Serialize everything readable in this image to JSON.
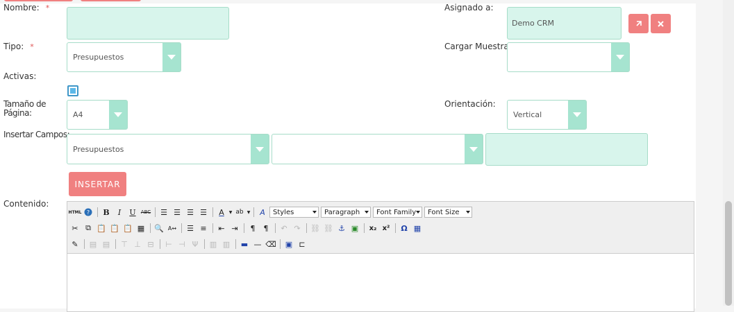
{
  "form": {
    "nombre": {
      "label": "Nombre:",
      "required_mark": "*",
      "value": ""
    },
    "asignado": {
      "label": "Asignado a:",
      "value": "Demo CRM",
      "select_icon": "select-arrow-icon",
      "clear_icon": "close-icon"
    },
    "tipo": {
      "label": "Tipo:",
      "required_mark": "*",
      "value": "Presupuestos"
    },
    "cargar_muestra": {
      "label": "Cargar Muestra:",
      "value": ""
    },
    "activas": {
      "label": "Activas:",
      "checked": true
    },
    "tamano": {
      "label_line1": "Tamaño de",
      "label_line2": "Página:",
      "value": "A4"
    },
    "orientacion": {
      "label": "Orientación:",
      "value": "Vertical"
    },
    "insertar_campos": {
      "label": "Insertar Campos:",
      "module": "Presupuestos",
      "field": "",
      "text": ""
    },
    "insert_button": "INSERTAR",
    "contenido": {
      "label": "Contenido:"
    }
  },
  "toolbar": {
    "styles": "Styles",
    "paragraph": "Paragraph",
    "font_family": "Font Family",
    "font_size": "Font Size"
  },
  "colors": {
    "accent_button": "#f08080",
    "input_fill": "#d8f5ec",
    "select_arrow": "#a6e4d0",
    "checkbox": "#5cb8e8"
  }
}
